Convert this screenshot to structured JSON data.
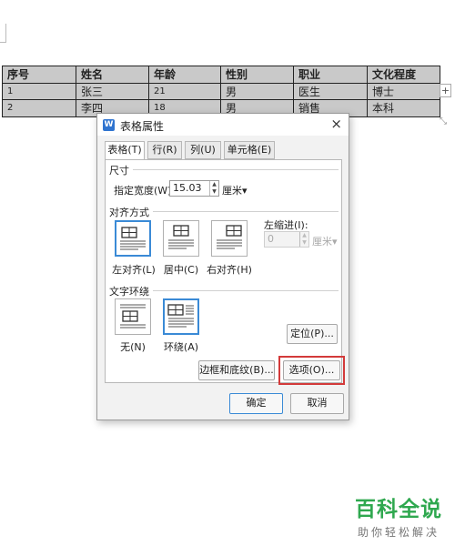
{
  "table": {
    "headers": [
      "序号",
      "姓名",
      "年龄",
      "性别",
      "职业",
      "文化程度"
    ],
    "rows": [
      [
        "1",
        "张三",
        "21",
        "男",
        "医生",
        "博士"
      ],
      [
        "2",
        "李四",
        "18",
        "男",
        "销售",
        "本科"
      ]
    ],
    "add_label": "+"
  },
  "dialog": {
    "app_icon": "W",
    "title": "表格属性",
    "close_label": "×",
    "tabs": [
      {
        "label": "表格(T)",
        "active": true
      },
      {
        "label": "行(R)",
        "active": false
      },
      {
        "label": "列(U)",
        "active": false
      },
      {
        "label": "单元格(E)",
        "active": false
      }
    ],
    "size": {
      "group_label": "尺寸",
      "width_label": "指定宽度(W):",
      "width_value": "15.03",
      "unit": "厘米▾"
    },
    "alignment": {
      "group_label": "对齐方式",
      "options": [
        {
          "label": "左对齐(L)",
          "selected": true
        },
        {
          "label": "居中(C)",
          "selected": false
        },
        {
          "label": "右对齐(H)",
          "selected": false
        }
      ],
      "indent_label": "左缩进(I):",
      "indent_value": "0",
      "indent_unit": "厘米▾"
    },
    "wrap": {
      "group_label": "文字环绕",
      "options": [
        {
          "label": "无(N)",
          "selected": false
        },
        {
          "label": "环绕(A)",
          "selected": true
        }
      ],
      "position_button": "定位(P)..."
    },
    "borders_button": "边框和底纹(B)...",
    "options_button": "选项(O)...",
    "ok_button": "确定",
    "cancel_button": "取消",
    "highlight_color": "#d33a3a",
    "accent_color": "#3a8ad6"
  },
  "watermark": {
    "logo": "百科全说",
    "subtitle": "助你轻松解决"
  }
}
